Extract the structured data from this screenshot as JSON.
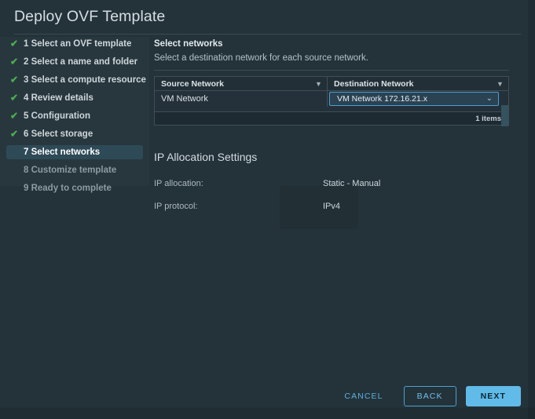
{
  "window": {
    "title": "Deploy OVF Template"
  },
  "sidebar": {
    "steps": [
      {
        "label": "1 Select an OVF template",
        "state": "done"
      },
      {
        "label": "2 Select a name and folder",
        "state": "done"
      },
      {
        "label": "3 Select a compute resource",
        "state": "done"
      },
      {
        "label": "4 Review details",
        "state": "done"
      },
      {
        "label": "5 Configuration",
        "state": "done"
      },
      {
        "label": "6 Select storage",
        "state": "done"
      },
      {
        "label": "7 Select networks",
        "state": "current"
      },
      {
        "label": "8 Customize template",
        "state": "pending"
      },
      {
        "label": "9 Ready to complete",
        "state": "pending"
      }
    ],
    "check_glyph": "✔"
  },
  "main": {
    "heading": "Select networks",
    "subheading": "Select a destination network for each source network.",
    "table": {
      "columns": [
        {
          "label": "Source Network",
          "filter_icon": "filter-icon"
        },
        {
          "label": "Destination Network",
          "filter_icon": "filter-icon"
        }
      ],
      "rows": [
        {
          "source": "VM Network",
          "destination_selected": "VM Network 172.16.21.x"
        }
      ],
      "footer_count": "1 items"
    },
    "ip_allocation": {
      "heading": "IP Allocation Settings",
      "fields": [
        {
          "label": "IP allocation:",
          "value": "Static - Manual"
        },
        {
          "label": "IP protocol:",
          "value": "IPv4"
        }
      ]
    }
  },
  "footer": {
    "cancel_label": "CANCEL",
    "back_label": "BACK",
    "next_label": "NEXT"
  },
  "icons": {
    "filter": "▼",
    "chevron_down": "⌄"
  },
  "colors": {
    "background": "#24333a",
    "accent_primary": "#61bbe8",
    "accent_link": "#59b0e0",
    "check_green": "#4caf50",
    "selected_step_bg": "#2e4a57",
    "dropdown_border": "#4b9fd1",
    "dropdown_bg": "#2b4252",
    "table_border": "#3f4e57"
  }
}
